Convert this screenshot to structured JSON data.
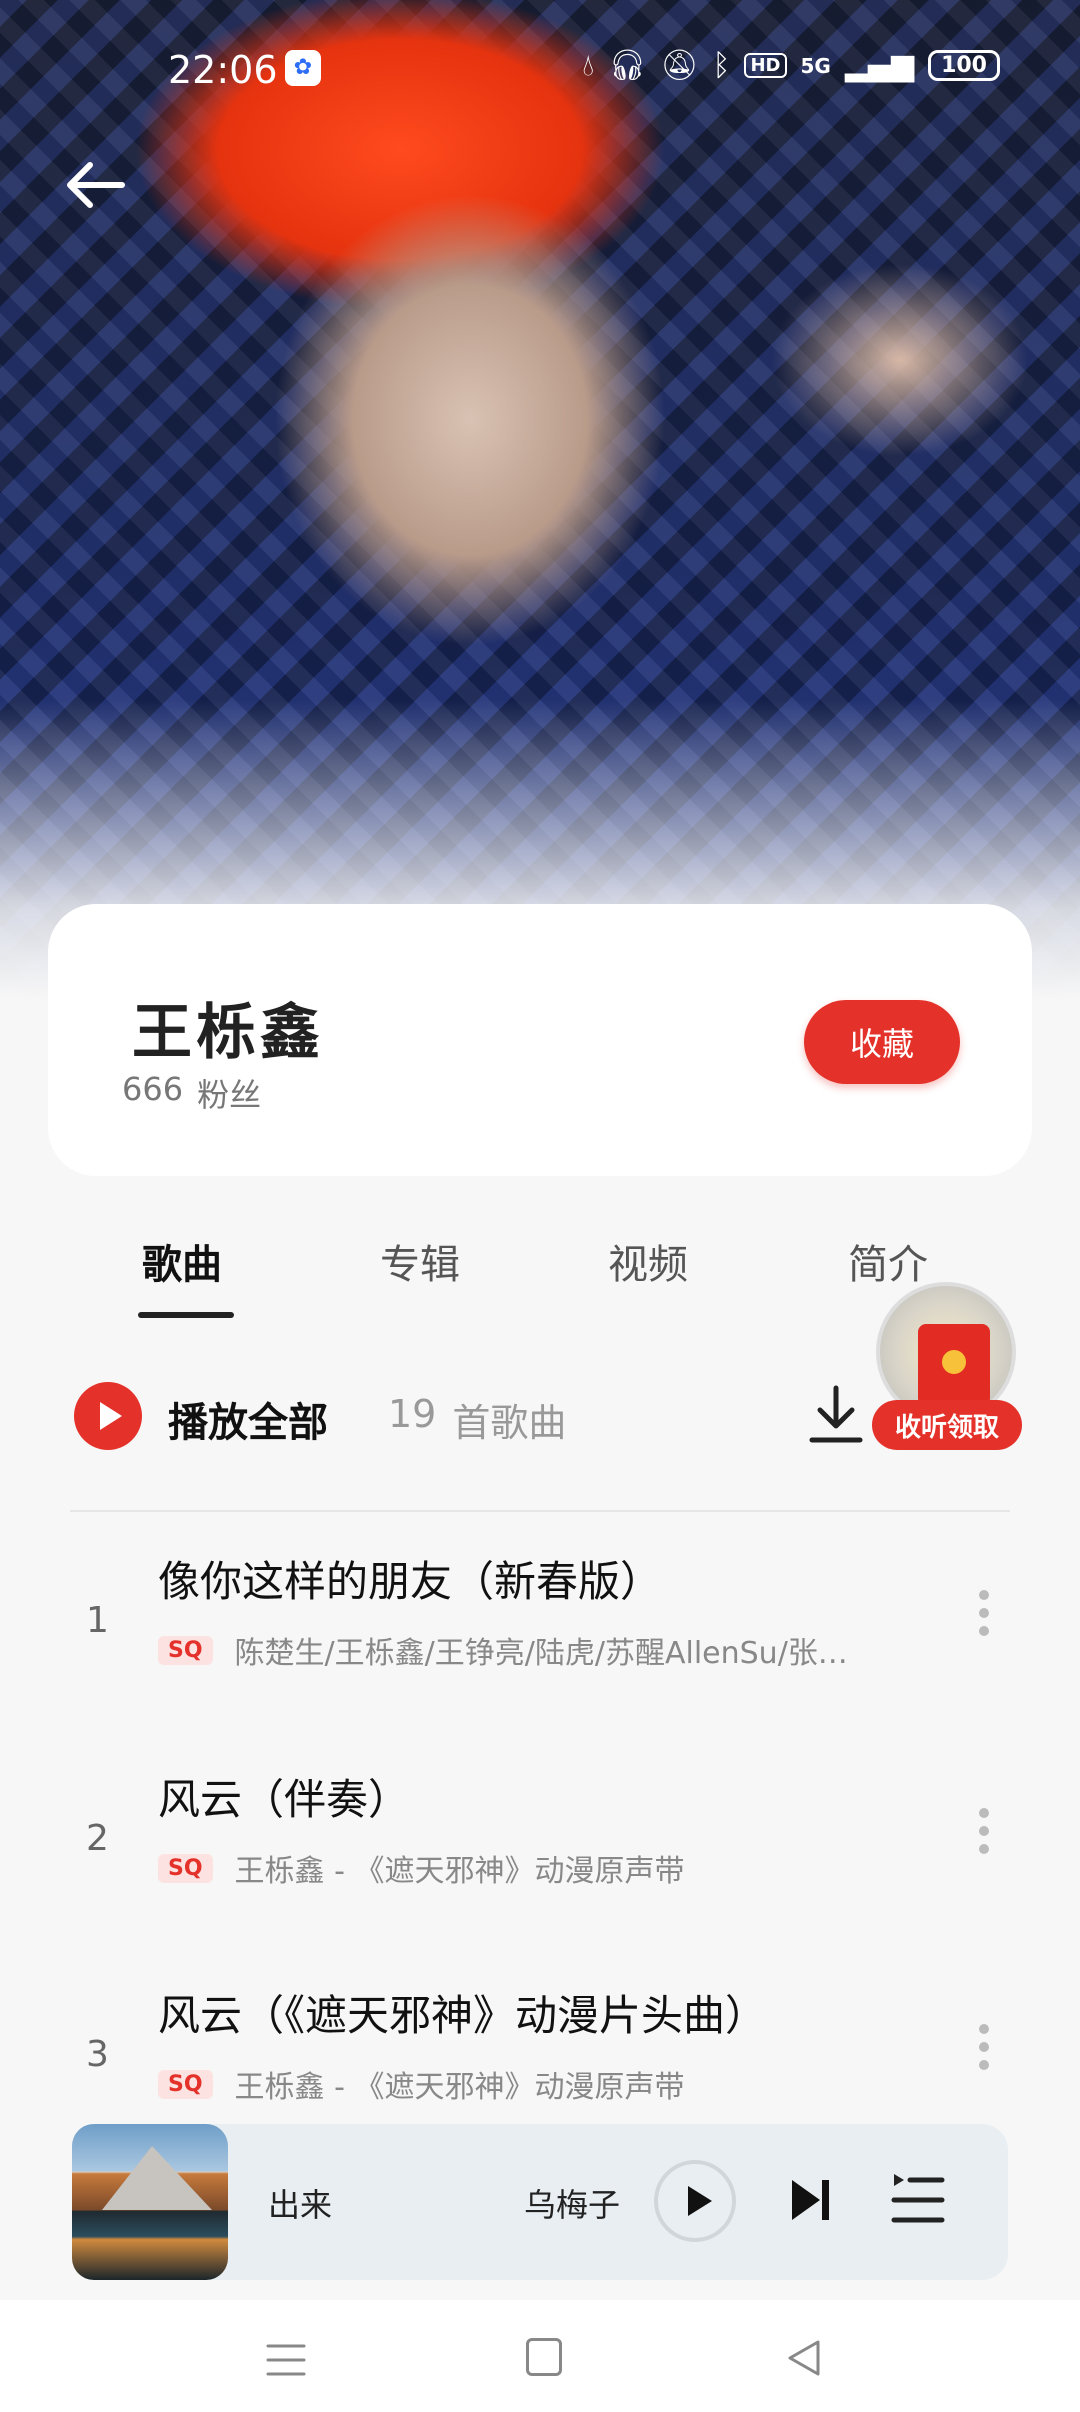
{
  "status_bar": {
    "time": "22:06",
    "app_icon": "baidu-paw-icon",
    "hd": "HD",
    "network": "5G",
    "battery": "100"
  },
  "artist": {
    "name": "王栎鑫",
    "fans_count": "666",
    "fans_label": "粉丝",
    "favorite_label": "收藏"
  },
  "tabs": [
    {
      "label": "歌曲",
      "active": true
    },
    {
      "label": "专辑",
      "active": false
    },
    {
      "label": "视频",
      "active": false
    },
    {
      "label": "简介",
      "active": false
    }
  ],
  "play_all": {
    "label": "播放全部",
    "count": "19",
    "unit": "首歌曲"
  },
  "red_packet": {
    "label": "收听领取"
  },
  "songs": [
    {
      "index": "1",
      "title": "像你这样的朋友（新春版）",
      "quality": "SQ",
      "artist": "陈楚生/王栎鑫/王铮亮/陆虎/苏醒AllenSu/张…"
    },
    {
      "index": "2",
      "title": "风云（伴奏）",
      "quality": "SQ",
      "artist": "王栎鑫 - 《遮天邪神》动漫原声带"
    },
    {
      "index": "3",
      "title": "风云（《遮天邪神》动漫片头曲）",
      "quality": "SQ",
      "artist": "王栎鑫 - 《遮天邪神》动漫原声带"
    }
  ],
  "now_playing": {
    "title": "出来",
    "artist": "乌梅子"
  },
  "colors": {
    "accent": "#e4322b",
    "background": "#f7f7f7",
    "player_bg": "#e8eef2"
  }
}
